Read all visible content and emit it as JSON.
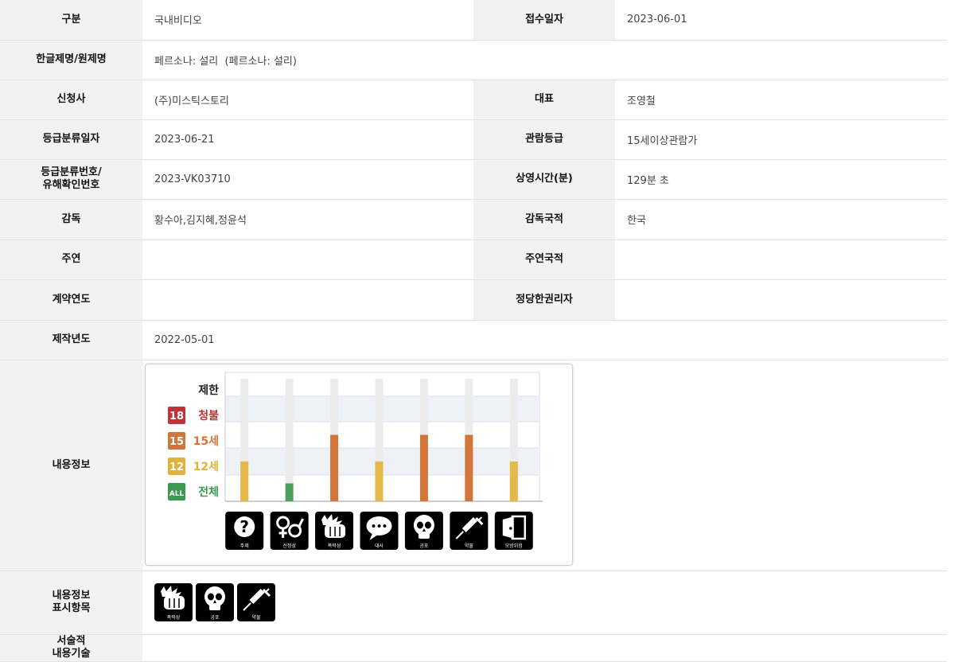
{
  "rows": [
    {
      "l1": "구분",
      "v1": "국내비디오",
      "l2": "접수일자",
      "v2": "2023-06-01"
    },
    {
      "l1": "한글제명/원제명",
      "v1": "페르소나: 설리  (페르소나: 설리)"
    },
    {
      "l1": "신청사",
      "v1": "(주)미스틱스토리",
      "l2": "대표",
      "v2": "조영철"
    },
    {
      "l1": "등급분류일자",
      "v1": "2023-06-21",
      "l2": "관람등급",
      "v2": "15세이상관람가"
    },
    {
      "l1a": "등급분류번호/",
      "l1b": "유해확인번호",
      "v1": "2023-VK03710",
      "l2": "상영시간(분)",
      "v2": "129분 초"
    },
    {
      "l1": "감독",
      "v1": "황수아,김지혜,정윤석",
      "l2": "감독국적",
      "v2": "한국"
    },
    {
      "l1": "주연",
      "v1": "",
      "l2": "주연국적",
      "v2": ""
    },
    {
      "l1": "계약연도",
      "v1": "",
      "l2": "정당한권리자",
      "v2": ""
    },
    {
      "l1": "제작년도",
      "v1": "2022-05-01"
    }
  ],
  "content_info": {
    "label": "내용정보",
    "legend": [
      {
        "badge": "",
        "text": "제한",
        "color": "#222222"
      },
      {
        "badge": "18",
        "text": "청불",
        "color": "#c0323a"
      },
      {
        "badge": "15",
        "text": "15세",
        "color": "#d2753a"
      },
      {
        "badge": "12",
        "text": "12세",
        "color": "#e3b23c"
      },
      {
        "badge": "ALL",
        "text": "전체",
        "color": "#3a9a4f"
      }
    ]
  },
  "chart_data": {
    "type": "bar",
    "categories": [
      "주제",
      "선정성",
      "폭력성",
      "대사",
      "공포",
      "약물",
      "모방위험"
    ],
    "levels": [
      "전체",
      "12세",
      "15세",
      "청불",
      "제한"
    ],
    "values": [
      "12세",
      "전체",
      "15세",
      "12세",
      "15세",
      "15세",
      "12세"
    ],
    "level_colors": {
      "전체": "#4e9f5b",
      "12세": "#e5b84a",
      "15세": "#d2753a",
      "청불": "#c0323a",
      "제한": "#222222"
    },
    "icons": [
      "question-icon",
      "gender-icon",
      "fist-icon",
      "speech-icon",
      "skull-icon",
      "syringe-icon",
      "door-icon"
    ]
  },
  "display_items": {
    "label1": "내용정보",
    "label2": "표시항목",
    "items": [
      {
        "icon": "fist-icon",
        "caption": "폭력성"
      },
      {
        "icon": "skull-icon",
        "caption": "공포"
      },
      {
        "icon": "syringe-icon",
        "caption": "약물"
      }
    ]
  },
  "narrative": {
    "label1": "서술적",
    "label2": "내용기술",
    "value": ""
  }
}
